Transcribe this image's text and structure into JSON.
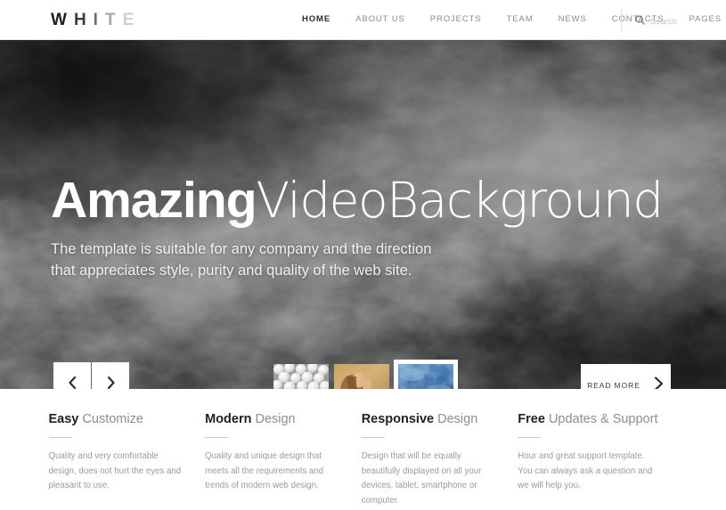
{
  "header": {
    "logo": {
      "letters": [
        "W",
        "H",
        "I",
        "T",
        "E"
      ],
      "full": "WHITE"
    },
    "nav": [
      {
        "label": "HOME",
        "active": true
      },
      {
        "label": "ABOUT US",
        "active": false
      },
      {
        "label": "PROJECTS",
        "active": false
      },
      {
        "label": "TEAM",
        "active": false
      },
      {
        "label": "NEWS",
        "active": false
      },
      {
        "label": "CONTACTS",
        "active": false
      },
      {
        "label": "PAGES",
        "active": false
      }
    ],
    "search": {
      "icon": "search-icon",
      "placeholder": "Search",
      "value": ""
    }
  },
  "hero": {
    "title_bold": "Amazing",
    "title_thin": "VideoBackground",
    "subtitle_line1": "The template is suitable for any company and the direction",
    "subtitle_line2": "that appreciates style, purity and quality of the web site.",
    "prev_icon": "chevron-left-icon",
    "next_icon": "chevron-right-icon",
    "read_more_label": "READ MORE",
    "read_more_icon": "chevron-right-icon",
    "thumbnails": [
      {
        "name": "white-balls",
        "active": false
      },
      {
        "name": "woman-portrait",
        "active": false
      },
      {
        "name": "blue-sky-clouds",
        "active": true
      }
    ]
  },
  "features": [
    {
      "lead": "Easy",
      "rest": "Customize",
      "text": "Quality and very comfortable design, does not hurt the eyes and pleasant to use."
    },
    {
      "lead": "Modern",
      "rest": "Design",
      "text": "Quality and unique design that meets all the requirements and trends of modern web design."
    },
    {
      "lead": "Responsive",
      "rest": "Design",
      "text": "Design that will be equally beautifully displayed on all your devices, tablet, smartphone or computer."
    },
    {
      "lead": "Free",
      "rest": "Updates & Support",
      "text": "Hour and great support template. You can always ask a question and we will help you."
    }
  ],
  "colors": {
    "page_background": "#ffffff",
    "text_dark": "#222222",
    "text_muted": "#9b9b9b",
    "nav_inactive": "#8d8d8d",
    "hero_button": "#ffffff",
    "rule": "#c9c9c9"
  }
}
